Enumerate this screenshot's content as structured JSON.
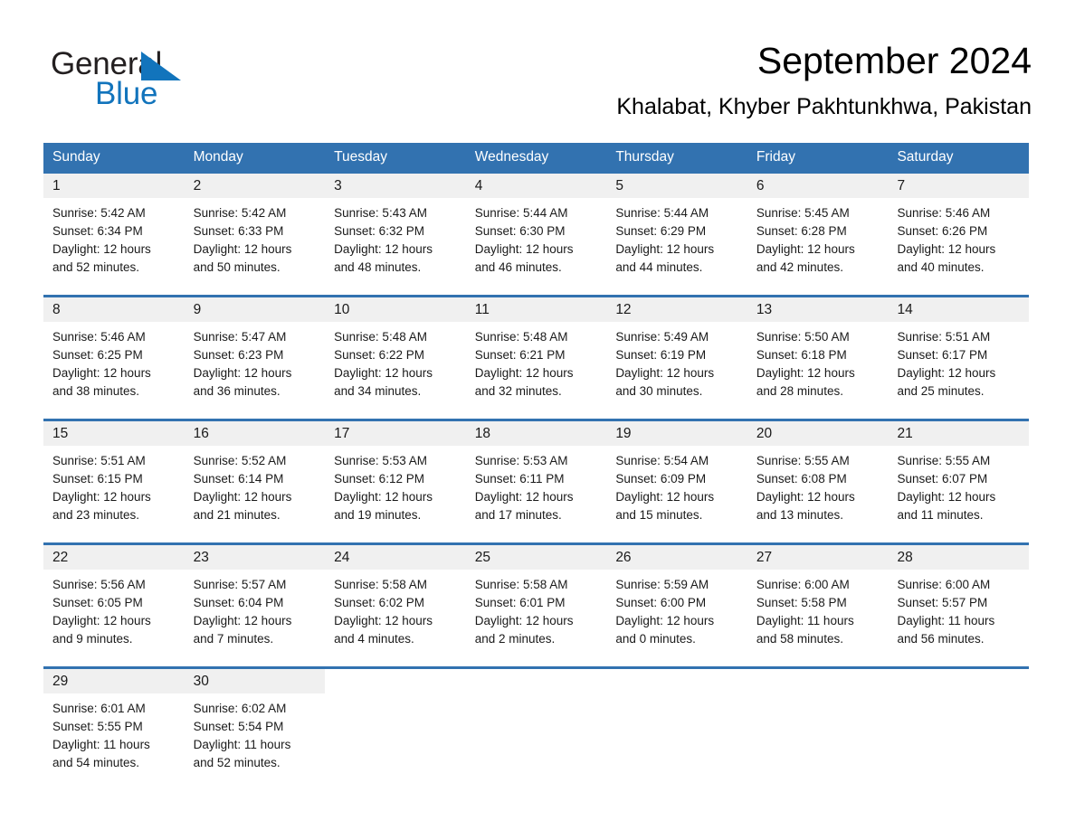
{
  "brand": {
    "name_dark": "General",
    "name_blue": "Blue",
    "accent_color": "#1274bc"
  },
  "header": {
    "title": "September 2024",
    "location": "Khalabat, Khyber Pakhtunkhwa, Pakistan"
  },
  "theme": {
    "header_blue": "#3272b0",
    "daynum_background": "#f0f0f0",
    "text_color": "#1a1a1a"
  },
  "weekdays": [
    "Sunday",
    "Monday",
    "Tuesday",
    "Wednesday",
    "Thursday",
    "Friday",
    "Saturday"
  ],
  "weeks": [
    [
      {
        "day": "1",
        "sunrise": "Sunrise: 5:42 AM",
        "sunset": "Sunset: 6:34 PM",
        "daylight_line1": "Daylight: 12 hours",
        "daylight_line2": "and 52 minutes."
      },
      {
        "day": "2",
        "sunrise": "Sunrise: 5:42 AM",
        "sunset": "Sunset: 6:33 PM",
        "daylight_line1": "Daylight: 12 hours",
        "daylight_line2": "and 50 minutes."
      },
      {
        "day": "3",
        "sunrise": "Sunrise: 5:43 AM",
        "sunset": "Sunset: 6:32 PM",
        "daylight_line1": "Daylight: 12 hours",
        "daylight_line2": "and 48 minutes."
      },
      {
        "day": "4",
        "sunrise": "Sunrise: 5:44 AM",
        "sunset": "Sunset: 6:30 PM",
        "daylight_line1": "Daylight: 12 hours",
        "daylight_line2": "and 46 minutes."
      },
      {
        "day": "5",
        "sunrise": "Sunrise: 5:44 AM",
        "sunset": "Sunset: 6:29 PM",
        "daylight_line1": "Daylight: 12 hours",
        "daylight_line2": "and 44 minutes."
      },
      {
        "day": "6",
        "sunrise": "Sunrise: 5:45 AM",
        "sunset": "Sunset: 6:28 PM",
        "daylight_line1": "Daylight: 12 hours",
        "daylight_line2": "and 42 minutes."
      },
      {
        "day": "7",
        "sunrise": "Sunrise: 5:46 AM",
        "sunset": "Sunset: 6:26 PM",
        "daylight_line1": "Daylight: 12 hours",
        "daylight_line2": "and 40 minutes."
      }
    ],
    [
      {
        "day": "8",
        "sunrise": "Sunrise: 5:46 AM",
        "sunset": "Sunset: 6:25 PM",
        "daylight_line1": "Daylight: 12 hours",
        "daylight_line2": "and 38 minutes."
      },
      {
        "day": "9",
        "sunrise": "Sunrise: 5:47 AM",
        "sunset": "Sunset: 6:23 PM",
        "daylight_line1": "Daylight: 12 hours",
        "daylight_line2": "and 36 minutes."
      },
      {
        "day": "10",
        "sunrise": "Sunrise: 5:48 AM",
        "sunset": "Sunset: 6:22 PM",
        "daylight_line1": "Daylight: 12 hours",
        "daylight_line2": "and 34 minutes."
      },
      {
        "day": "11",
        "sunrise": "Sunrise: 5:48 AM",
        "sunset": "Sunset: 6:21 PM",
        "daylight_line1": "Daylight: 12 hours",
        "daylight_line2": "and 32 minutes."
      },
      {
        "day": "12",
        "sunrise": "Sunrise: 5:49 AM",
        "sunset": "Sunset: 6:19 PM",
        "daylight_line1": "Daylight: 12 hours",
        "daylight_line2": "and 30 minutes."
      },
      {
        "day": "13",
        "sunrise": "Sunrise: 5:50 AM",
        "sunset": "Sunset: 6:18 PM",
        "daylight_line1": "Daylight: 12 hours",
        "daylight_line2": "and 28 minutes."
      },
      {
        "day": "14",
        "sunrise": "Sunrise: 5:51 AM",
        "sunset": "Sunset: 6:17 PM",
        "daylight_line1": "Daylight: 12 hours",
        "daylight_line2": "and 25 minutes."
      }
    ],
    [
      {
        "day": "15",
        "sunrise": "Sunrise: 5:51 AM",
        "sunset": "Sunset: 6:15 PM",
        "daylight_line1": "Daylight: 12 hours",
        "daylight_line2": "and 23 minutes."
      },
      {
        "day": "16",
        "sunrise": "Sunrise: 5:52 AM",
        "sunset": "Sunset: 6:14 PM",
        "daylight_line1": "Daylight: 12 hours",
        "daylight_line2": "and 21 minutes."
      },
      {
        "day": "17",
        "sunrise": "Sunrise: 5:53 AM",
        "sunset": "Sunset: 6:12 PM",
        "daylight_line1": "Daylight: 12 hours",
        "daylight_line2": "and 19 minutes."
      },
      {
        "day": "18",
        "sunrise": "Sunrise: 5:53 AM",
        "sunset": "Sunset: 6:11 PM",
        "daylight_line1": "Daylight: 12 hours",
        "daylight_line2": "and 17 minutes."
      },
      {
        "day": "19",
        "sunrise": "Sunrise: 5:54 AM",
        "sunset": "Sunset: 6:09 PM",
        "daylight_line1": "Daylight: 12 hours",
        "daylight_line2": "and 15 minutes."
      },
      {
        "day": "20",
        "sunrise": "Sunrise: 5:55 AM",
        "sunset": "Sunset: 6:08 PM",
        "daylight_line1": "Daylight: 12 hours",
        "daylight_line2": "and 13 minutes."
      },
      {
        "day": "21",
        "sunrise": "Sunrise: 5:55 AM",
        "sunset": "Sunset: 6:07 PM",
        "daylight_line1": "Daylight: 12 hours",
        "daylight_line2": "and 11 minutes."
      }
    ],
    [
      {
        "day": "22",
        "sunrise": "Sunrise: 5:56 AM",
        "sunset": "Sunset: 6:05 PM",
        "daylight_line1": "Daylight: 12 hours",
        "daylight_line2": "and 9 minutes."
      },
      {
        "day": "23",
        "sunrise": "Sunrise: 5:57 AM",
        "sunset": "Sunset: 6:04 PM",
        "daylight_line1": "Daylight: 12 hours",
        "daylight_line2": "and 7 minutes."
      },
      {
        "day": "24",
        "sunrise": "Sunrise: 5:58 AM",
        "sunset": "Sunset: 6:02 PM",
        "daylight_line1": "Daylight: 12 hours",
        "daylight_line2": "and 4 minutes."
      },
      {
        "day": "25",
        "sunrise": "Sunrise: 5:58 AM",
        "sunset": "Sunset: 6:01 PM",
        "daylight_line1": "Daylight: 12 hours",
        "daylight_line2": "and 2 minutes."
      },
      {
        "day": "26",
        "sunrise": "Sunrise: 5:59 AM",
        "sunset": "Sunset: 6:00 PM",
        "daylight_line1": "Daylight: 12 hours",
        "daylight_line2": "and 0 minutes."
      },
      {
        "day": "27",
        "sunrise": "Sunrise: 6:00 AM",
        "sunset": "Sunset: 5:58 PM",
        "daylight_line1": "Daylight: 11 hours",
        "daylight_line2": "and 58 minutes."
      },
      {
        "day": "28",
        "sunrise": "Sunrise: 6:00 AM",
        "sunset": "Sunset: 5:57 PM",
        "daylight_line1": "Daylight: 11 hours",
        "daylight_line2": "and 56 minutes."
      }
    ],
    [
      {
        "day": "29",
        "sunrise": "Sunrise: 6:01 AM",
        "sunset": "Sunset: 5:55 PM",
        "daylight_line1": "Daylight: 11 hours",
        "daylight_line2": "and 54 minutes."
      },
      {
        "day": "30",
        "sunrise": "Sunrise: 6:02 AM",
        "sunset": "Sunset: 5:54 PM",
        "daylight_line1": "Daylight: 11 hours",
        "daylight_line2": "and 52 minutes."
      },
      {
        "day": "",
        "sunrise": "",
        "sunset": "",
        "daylight_line1": "",
        "daylight_line2": ""
      },
      {
        "day": "",
        "sunrise": "",
        "sunset": "",
        "daylight_line1": "",
        "daylight_line2": ""
      },
      {
        "day": "",
        "sunrise": "",
        "sunset": "",
        "daylight_line1": "",
        "daylight_line2": ""
      },
      {
        "day": "",
        "sunrise": "",
        "sunset": "",
        "daylight_line1": "",
        "daylight_line2": ""
      },
      {
        "day": "",
        "sunrise": "",
        "sunset": "",
        "daylight_line1": "",
        "daylight_line2": ""
      }
    ]
  ]
}
